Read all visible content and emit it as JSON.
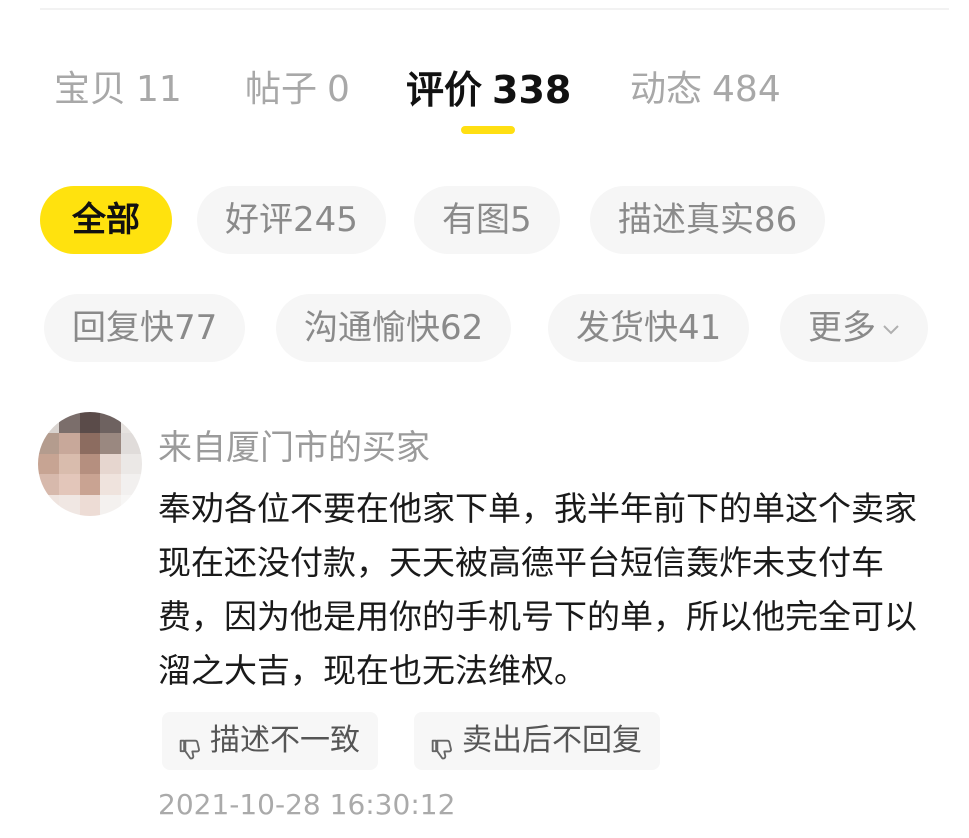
{
  "tabs": [
    {
      "label": "宝贝",
      "count": "11"
    },
    {
      "label": "帖子",
      "count": "0"
    },
    {
      "label": "评价",
      "count": "338"
    },
    {
      "label": "动态",
      "count": "484"
    }
  ],
  "active_tab": "评价",
  "filters_row1": [
    "全部",
    "好评245",
    "有图5",
    "描述真实86"
  ],
  "filters_row2": [
    "回复快77",
    "沟通愉快62",
    "发货快41",
    "更多"
  ],
  "review": {
    "reviewer": "来自厦门市的买家",
    "text": "奉劝各位不要在他家下单，我半年前下的单这个卖家现在还没付款，天天被高德平台短信轰炸未支付车费，因为他是用你的手机号下的单，所以他完全可以溜之大吉，现在也无法维权。",
    "tags": [
      "描述不一致",
      "卖出后不回复"
    ],
    "timestamp": "2021-10-28 16:30:12"
  },
  "colors": {
    "accent": "#ffdf12",
    "chip_bg": "#f6f6f6"
  },
  "icons": {
    "tag_icon": "thumbs-down-icon",
    "more_icon": "chevron-down-icon"
  }
}
